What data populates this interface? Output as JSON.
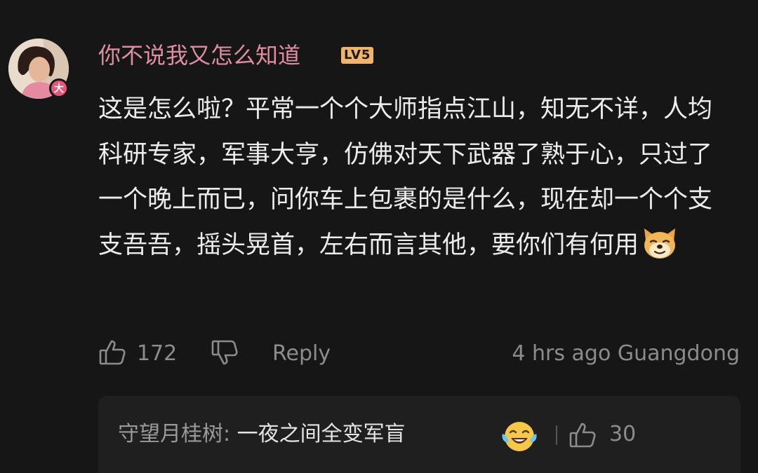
{
  "comment": {
    "username": "你不说我又怎么知道",
    "level": "LV5",
    "avatar_badge": "大",
    "text": "这是怎么啦？平常一个个大师指点江山，知无不详，人均科研专家，军事大亨，仿佛对天下武器了熟于心，只过了一个晚上而已，问你车上包裹的是什么，现在却一个个支支吾吾，摇头晃首，左右而言其他，要你们有何用",
    "emoji": "doge-emoji",
    "likes": "172",
    "reply_label": "Reply",
    "meta": "4 hrs ago Guangdong"
  },
  "reply_preview": {
    "author": "守望月桂树:",
    "text": " 一夜之间全变军盲",
    "emoji": "laugh-cry-emoji",
    "likes": "30"
  },
  "colors": {
    "background": "#161616",
    "username": "#df8da3",
    "level_badge": "#f2b46b",
    "avatar_badge": "#e4577a",
    "muted": "#8c8c8c"
  }
}
